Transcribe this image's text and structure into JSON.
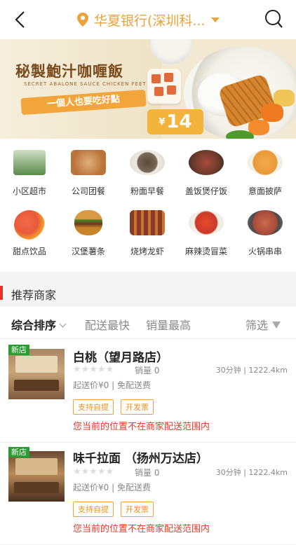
{
  "header": {
    "location": "华夏银行(深圳科..."
  },
  "banner": {
    "title": "秘製鮑汁咖喱飯",
    "subtitle": "SECRET ABALONE SAUCE CHICKEN FEET RICE",
    "slogan": "一個人也要吃好點",
    "price_currency": "¥",
    "price": "14"
  },
  "categories": [
    {
      "label": "小区超市",
      "icon": "supermarket-icon",
      "color": "#5a8a4a"
    },
    {
      "label": "公司团餐",
      "icon": "lunchbox-icon",
      "color": "#b8743a"
    },
    {
      "label": "粉面早餐",
      "icon": "noodle-bowl-icon",
      "color": "#7a6a5a"
    },
    {
      "label": "盖饭煲仔饭",
      "icon": "claypot-rice-icon",
      "color": "#6a3a2a"
    },
    {
      "label": "意面披萨",
      "icon": "pasta-icon",
      "color": "#e89a3a"
    },
    {
      "label": "甜点饮品",
      "icon": "drink-icon",
      "color": "#e85a3a"
    },
    {
      "label": "汉堡薯条",
      "icon": "burger-icon",
      "color": "#c8842a"
    },
    {
      "label": "烧烤龙虾",
      "icon": "skewer-icon",
      "color": "#8a3a2a"
    },
    {
      "label": "麻辣烫冒菜",
      "icon": "spicy-soup-icon",
      "color": "#c83a2a"
    },
    {
      "label": "火锅串串",
      "icon": "hotpot-icon",
      "color": "#a84a3a"
    }
  ],
  "section": {
    "title": "推荐商家"
  },
  "tabs": {
    "sort": "综合排序",
    "fast": "配送最快",
    "sales": "销量最高",
    "filter": "筛选"
  },
  "shops": [
    {
      "tag": "新店",
      "name": "白桃（望月路店）",
      "stars": "★★★★★",
      "sales": "销量 0",
      "meta": "30分钟 | 1222.4km",
      "fee": "起送价¥0 | 免配送费",
      "badge1": "支持自提",
      "badge2": "开发票",
      "warn": "您当前的位置不在商家配送范围内"
    },
    {
      "tag": "新店",
      "name": "味千拉面 （扬州万达店）",
      "stars": "★★★★★",
      "sales": "销量 0",
      "meta": "30分钟 | 1222.4km",
      "fee": "起送价¥0 | 免配送费",
      "badge1": "支持自提",
      "badge2": "开发票",
      "warn": "您当前的位置不在商家配送范围内"
    }
  ]
}
